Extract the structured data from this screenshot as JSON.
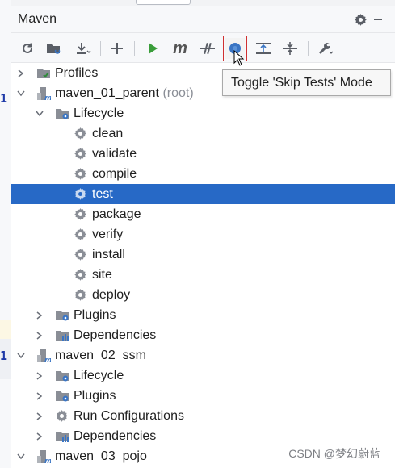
{
  "panel": {
    "title": "Maven"
  },
  "toolbar": {
    "icons": [
      "refresh-icon",
      "add-maven-project-icon",
      "download-icon",
      "plus-icon",
      "run-icon",
      "execute-goal-icon",
      "toggle-offline-icon",
      "skip-tests-icon",
      "show-dependencies-icon",
      "collapse-all-icon",
      "settings-wrench-icon"
    ],
    "execute_label": "m"
  },
  "tooltip": {
    "text": "Toggle 'Skip Tests' Mode"
  },
  "tree": {
    "profiles": "Profiles",
    "projects": [
      {
        "name": "maven_01_parent",
        "suffix": "(root)"
      },
      {
        "name": "maven_02_ssm"
      },
      {
        "name": "maven_03_pojo"
      }
    ],
    "lifecycle": "Lifecycle",
    "plugins": "Plugins",
    "dependencies": "Dependencies",
    "run_configurations": "Run Configurations",
    "goals": [
      "clean",
      "validate",
      "compile",
      "test",
      "package",
      "verify",
      "install",
      "site",
      "deploy"
    ],
    "selected_goal": "test"
  },
  "editor": {
    "gutter_mark": "1"
  },
  "watermark": "CSDN @梦幻蔚蓝",
  "colors": {
    "selection": "#2769c6",
    "run_green": "#3a9d3a",
    "tooltip_border": "#a9a9a9",
    "highlight_box": "#d03030"
  }
}
